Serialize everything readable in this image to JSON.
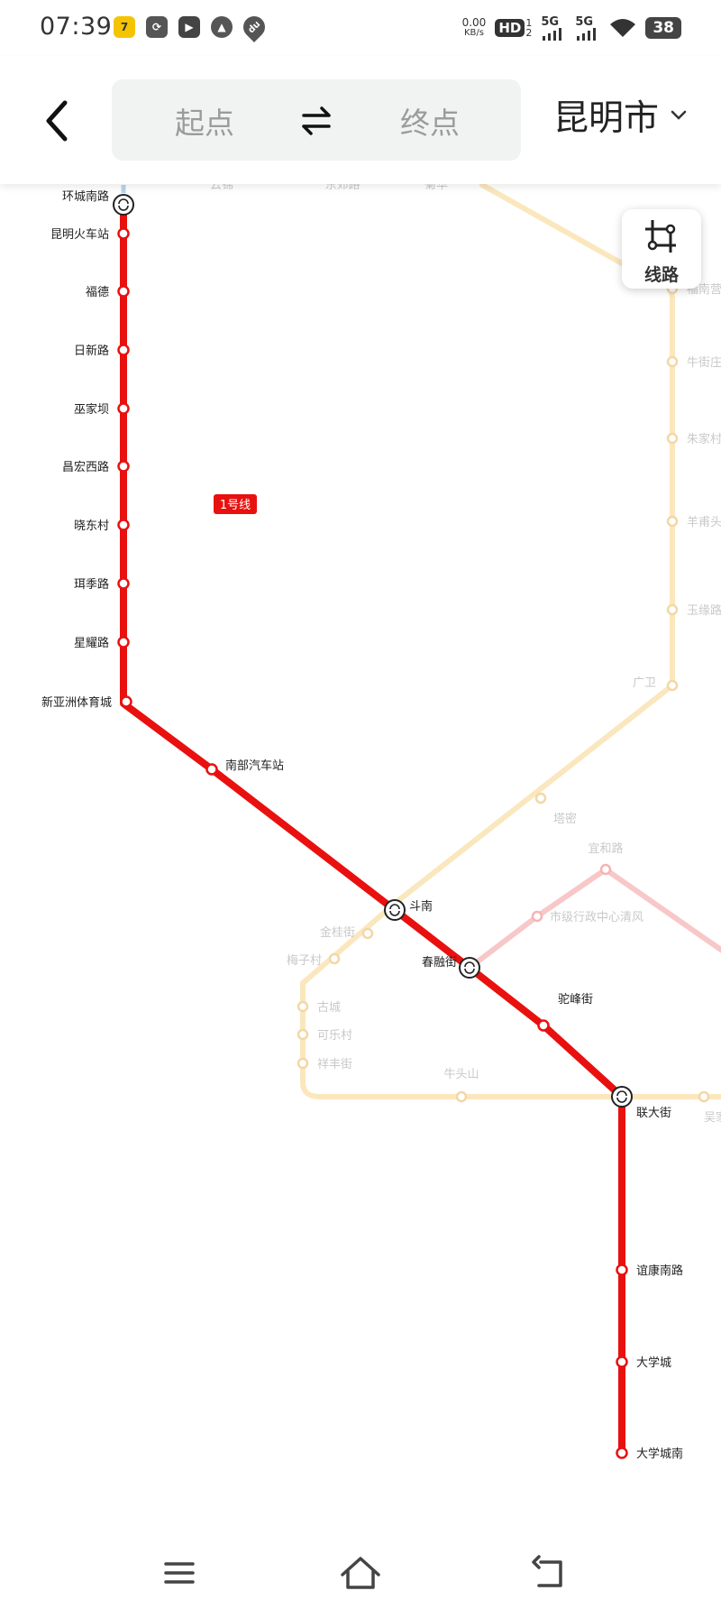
{
  "status_bar": {
    "time": "07:39",
    "speed_value": "0.00",
    "speed_unit": "KB/s",
    "hd_label": "HD",
    "hd_sup": "1",
    "hd_sub": "2",
    "signal1": "5G",
    "signal2": "5G",
    "battery": "38",
    "app_icons": [
      "tencent-video-app-icon",
      "sync-app-icon",
      "play-app-icon",
      "maps-app-icon",
      "du-location-app-icon"
    ]
  },
  "header": {
    "start_placeholder": "起点",
    "end_placeholder": "终点",
    "city": "昆明市"
  },
  "line_button": {
    "label": "线路"
  },
  "map": {
    "line_badge": "1号线",
    "colors": {
      "line1": "#e8110f",
      "line_beige": "#fbe7bd",
      "line_pink": "#f8c7c7"
    },
    "top_partial_labels": [
      "云锦",
      "东郊路",
      "菊华"
    ],
    "line1_stations": [
      {
        "name": "环城南路",
        "transfer": true
      },
      {
        "name": "昆明火车站",
        "transfer": false
      },
      {
        "name": "福德",
        "transfer": false
      },
      {
        "name": "日新路",
        "transfer": false
      },
      {
        "name": "巫家坝",
        "transfer": false
      },
      {
        "name": "昌宏西路",
        "transfer": false
      },
      {
        "name": "晓东村",
        "transfer": false
      },
      {
        "name": "珥季路",
        "transfer": false
      },
      {
        "name": "星耀路",
        "transfer": false
      },
      {
        "name": "新亚洲体育城",
        "transfer": false
      },
      {
        "name": "南部汽车站",
        "transfer": false
      },
      {
        "name": "斗南",
        "transfer": true
      },
      {
        "name": "春融街",
        "transfer": true
      },
      {
        "name": "驼峰街",
        "transfer": false
      },
      {
        "name": "联大街",
        "transfer": true
      },
      {
        "name": "谊康南路",
        "transfer": false
      },
      {
        "name": "大学城",
        "transfer": false
      },
      {
        "name": "大学城南",
        "transfer": false
      }
    ],
    "faded_stations": [
      "福南营",
      "牛街庄",
      "朱家村",
      "羊甫头",
      "玉缘路",
      "广卫",
      "塔密",
      "宜和路",
      "市级行政中心清风",
      "金桂街",
      "梅子村",
      "古城",
      "可乐村",
      "祥丰街",
      "牛头山",
      "吴家营"
    ]
  },
  "nav_bar": {
    "items": [
      "menu",
      "home",
      "back"
    ]
  }
}
